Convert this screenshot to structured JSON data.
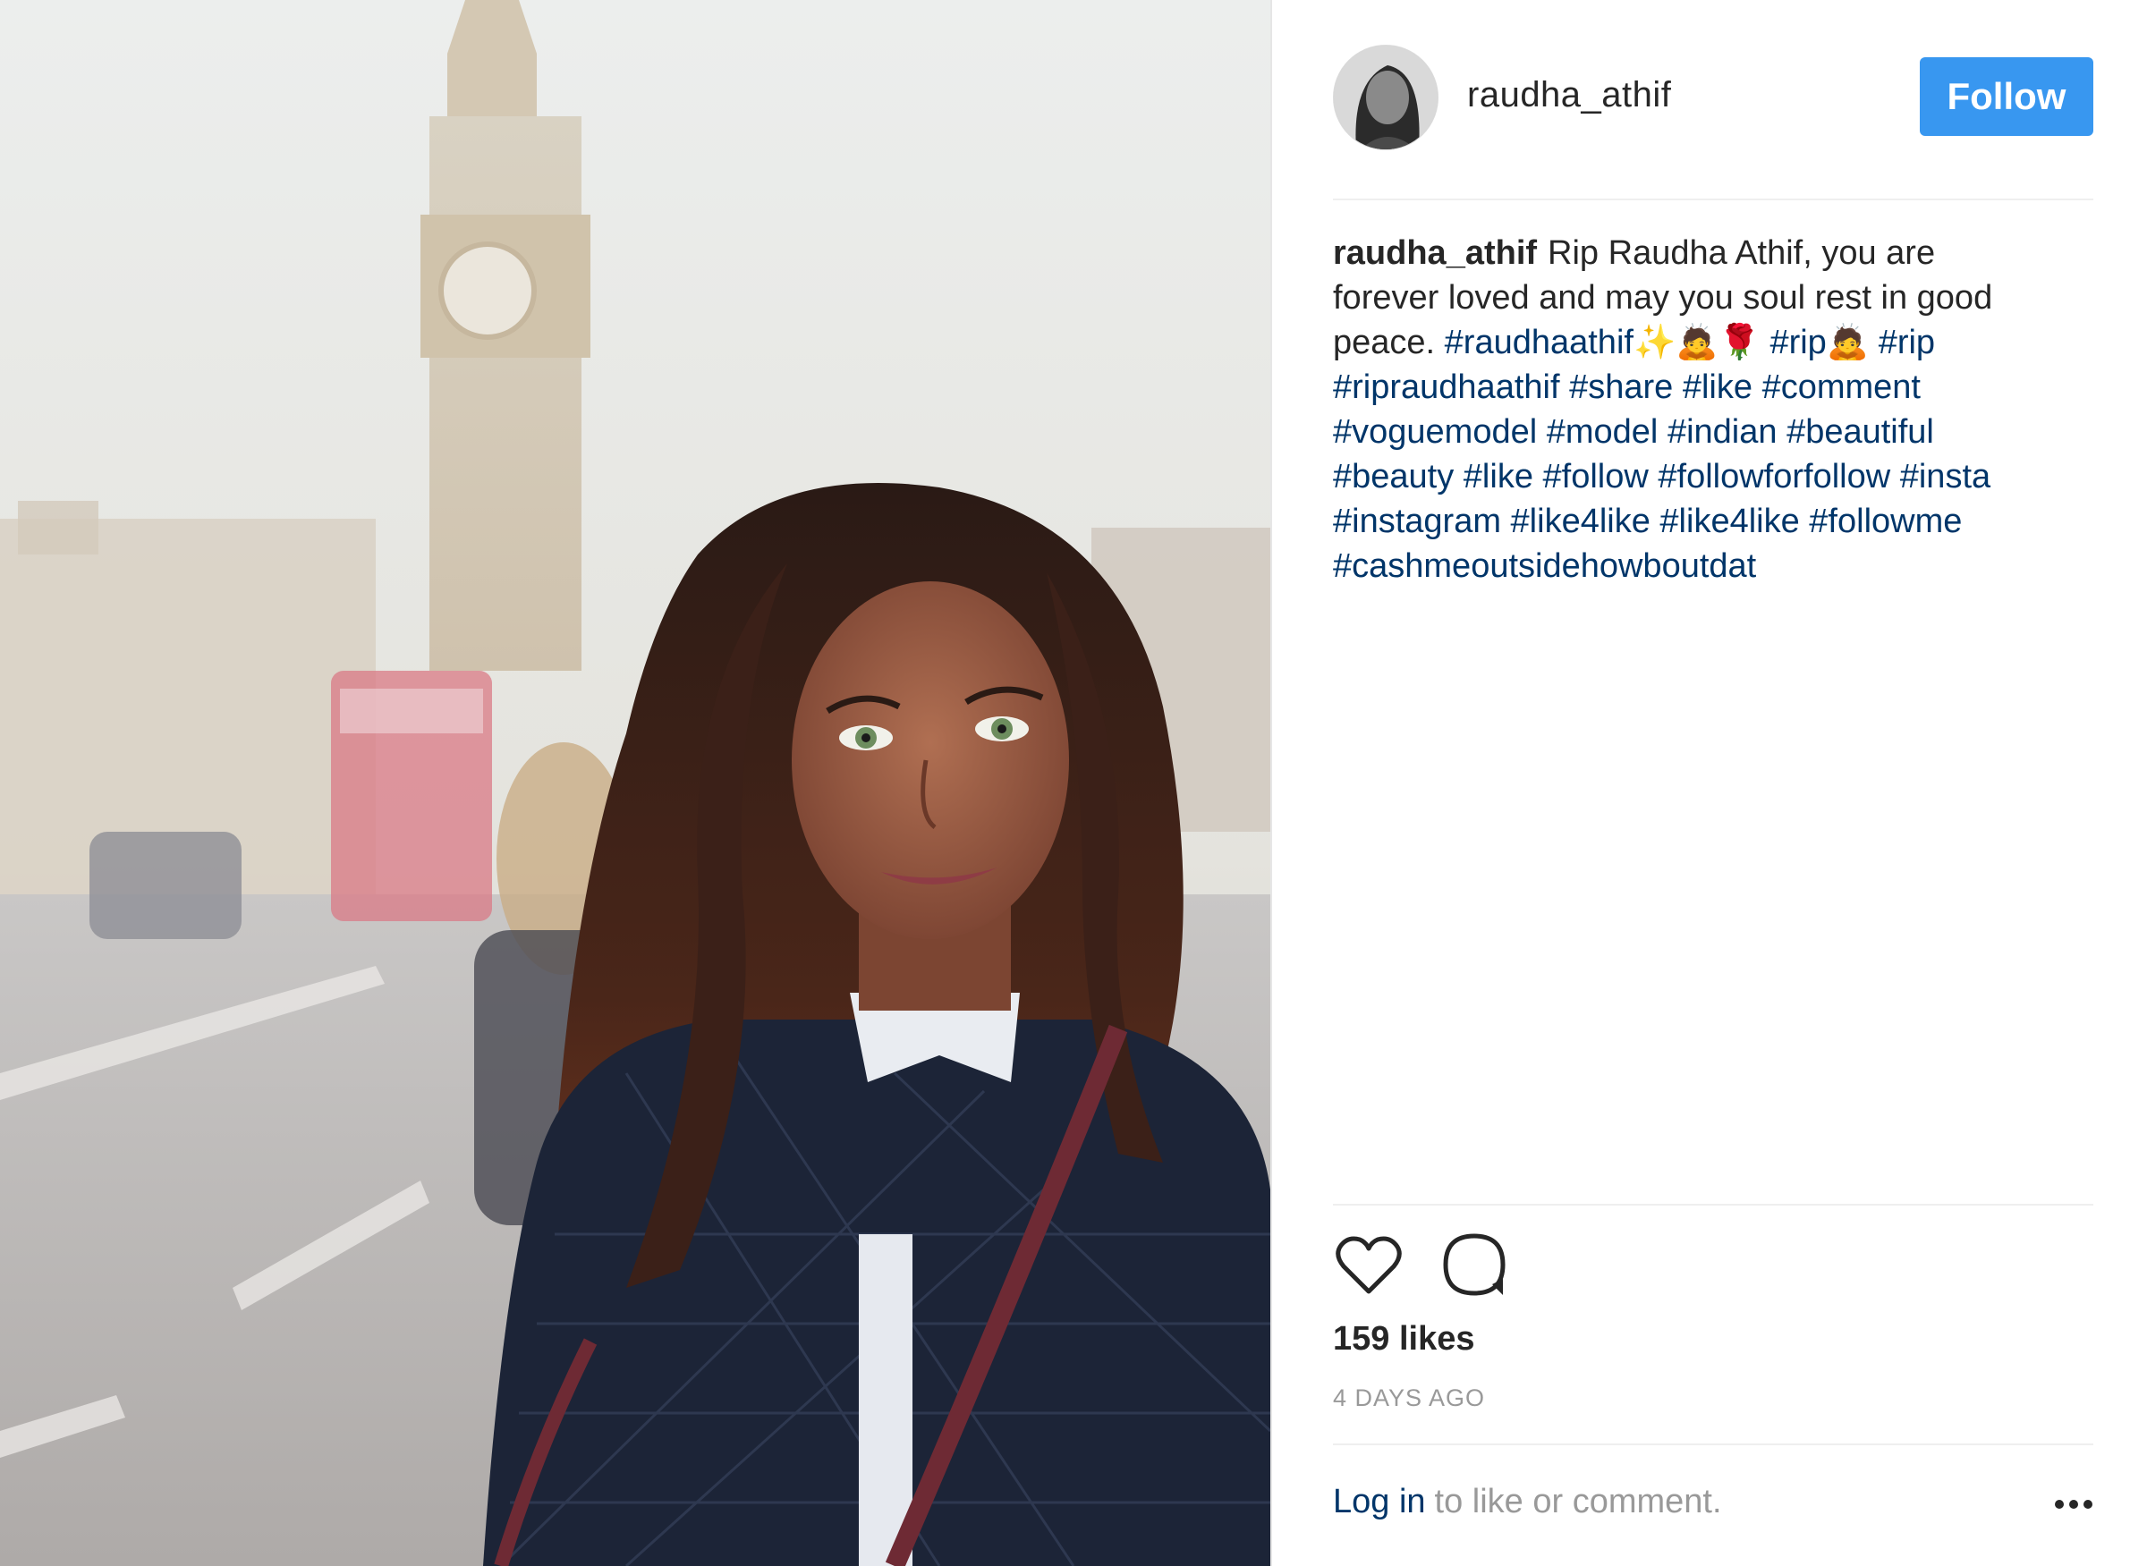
{
  "post": {
    "username": "raudha_athif",
    "follow_label": "Follow",
    "caption": {
      "user": "raudha_athif",
      "lines": [
        [
          {
            "t": "text",
            "v": "Rip Raudha Athif, you are"
          }
        ],
        [
          {
            "t": "text",
            "v": "forever loved and may you soul rest in good"
          }
        ],
        [
          {
            "t": "text",
            "v": "peace. "
          },
          {
            "t": "tag",
            "v": "#raudhaathif✨🙇🌹"
          },
          {
            "t": "text",
            "v": " "
          },
          {
            "t": "tag",
            "v": "#rip🙇"
          },
          {
            "t": "text",
            "v": " "
          },
          {
            "t": "tag",
            "v": "#rip"
          }
        ],
        [
          {
            "t": "tag",
            "v": "#ripraudhaathif"
          },
          {
            "t": "text",
            "v": " "
          },
          {
            "t": "tag",
            "v": "#share"
          },
          {
            "t": "text",
            "v": " "
          },
          {
            "t": "tag",
            "v": "#like"
          },
          {
            "t": "text",
            "v": " "
          },
          {
            "t": "tag",
            "v": "#comment"
          }
        ],
        [
          {
            "t": "tag",
            "v": "#voguemodel"
          },
          {
            "t": "text",
            "v": " "
          },
          {
            "t": "tag",
            "v": "#model"
          },
          {
            "t": "text",
            "v": " "
          },
          {
            "t": "tag",
            "v": "#indian"
          },
          {
            "t": "text",
            "v": " "
          },
          {
            "t": "tag",
            "v": "#beautiful"
          }
        ],
        [
          {
            "t": "tag",
            "v": "#beauty"
          },
          {
            "t": "text",
            "v": " "
          },
          {
            "t": "tag",
            "v": "#like"
          },
          {
            "t": "text",
            "v": " "
          },
          {
            "t": "tag",
            "v": "#follow"
          },
          {
            "t": "text",
            "v": " "
          },
          {
            "t": "tag",
            "v": "#followforfollow"
          },
          {
            "t": "text",
            "v": " "
          },
          {
            "t": "tag",
            "v": "#insta"
          }
        ],
        [
          {
            "t": "tag",
            "v": "#instagram"
          },
          {
            "t": "text",
            "v": " "
          },
          {
            "t": "tag",
            "v": "#like4like"
          },
          {
            "t": "text",
            "v": " "
          },
          {
            "t": "tag",
            "v": "#like4like"
          },
          {
            "t": "text",
            "v": " "
          },
          {
            "t": "tag",
            "v": "#followme"
          }
        ],
        [
          {
            "t": "tag",
            "v": "#cashmeoutsidehowboutdat"
          }
        ]
      ]
    },
    "likes": "159 likes",
    "timestamp": "4 DAYS AGO",
    "login_link": "Log in",
    "login_rest": "to like or comment."
  },
  "icons": {
    "like": "heart-outline-icon",
    "comment": "speech-bubble-icon",
    "more": "more-dots-icon"
  },
  "colors": {
    "follow_button": "#3897f0",
    "hashtag": "#003569",
    "text": "#262626",
    "muted": "#999999"
  }
}
